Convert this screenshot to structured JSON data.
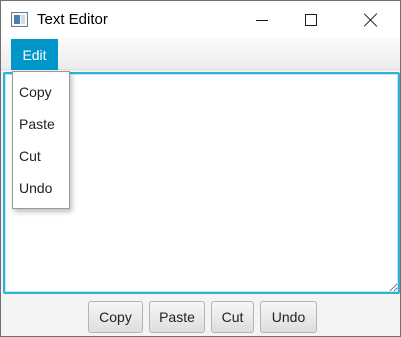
{
  "window": {
    "title": "Text Editor"
  },
  "menubar": {
    "edit_label": "Edit"
  },
  "edit_menu": {
    "items": [
      "Copy",
      "Paste",
      "Cut",
      "Undo"
    ]
  },
  "editor": {
    "value": ""
  },
  "toolbar": {
    "copy_label": "Copy",
    "paste_label": "Paste",
    "cut_label": "Cut",
    "undo_label": "Undo"
  },
  "colors": {
    "accent": "#0096c9",
    "focus_border": "#2fb2d6"
  },
  "icons": {
    "app": "app-window-icon",
    "minimize": "minimize-icon",
    "maximize": "maximize-icon",
    "close": "close-icon"
  }
}
